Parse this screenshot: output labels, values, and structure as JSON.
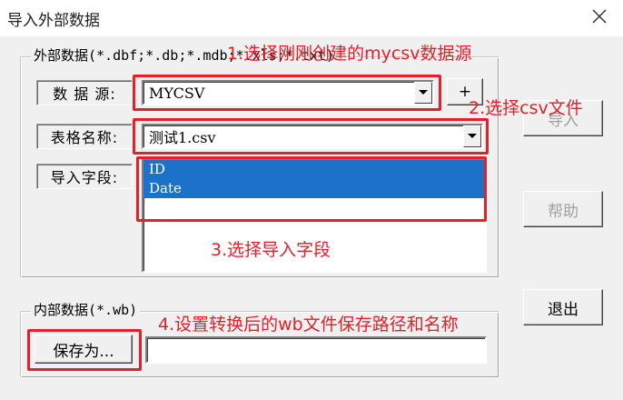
{
  "window": {
    "title": "导入外部数据",
    "close_icon": "close-icon"
  },
  "external_group": {
    "caption": "外部数据(*.dbf;*.db;*.mdb;*.xls;*.txt)",
    "datasource_label": "数 据 源:",
    "datasource_value": "MYCSV",
    "add_label": "+",
    "table_label": "表格名称:",
    "table_value": "测试1.csv",
    "fields_label": "导入字段:",
    "fields": [
      "ID",
      "Date"
    ]
  },
  "internal_group": {
    "caption": "内部数据(*.wb)",
    "save_as_label": "保存为...",
    "save_path_value": ""
  },
  "buttons": {
    "import_label": "导入",
    "help_label": "帮助",
    "exit_label": "退出"
  },
  "annotations": {
    "step1": "1.选择刚刚创建的mycsv数据源",
    "step2": "2.选择csv文件",
    "step3": "3.选择导入字段",
    "step4": "4.设置转换后的wb文件保存路径和名称",
    "color": "#e5202a"
  }
}
